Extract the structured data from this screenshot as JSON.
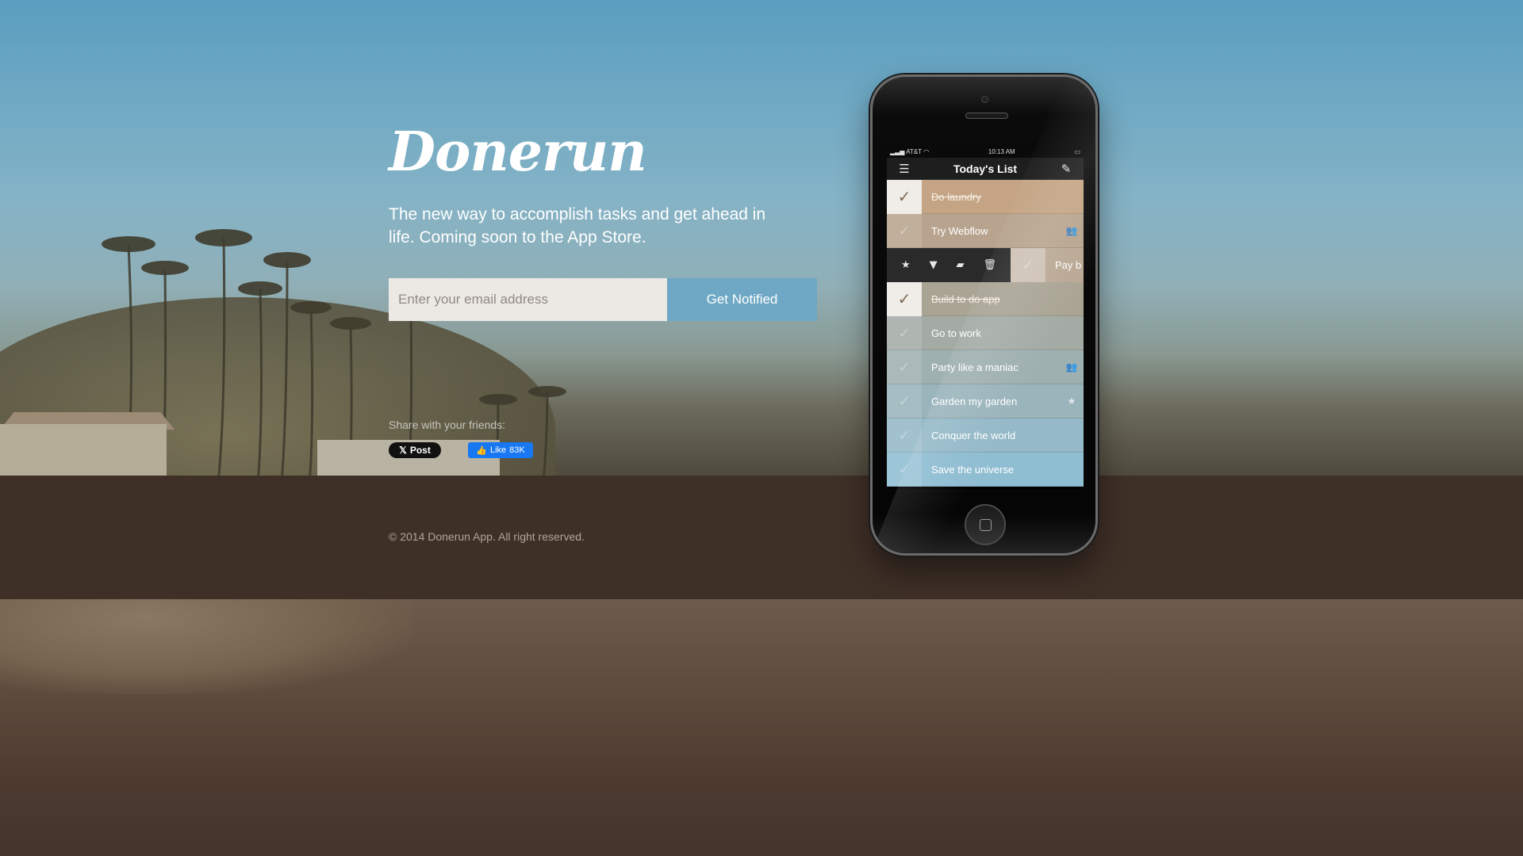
{
  "brand": {
    "logo_text": "Donerun"
  },
  "hero": {
    "tagline": "The new way to accomplish tasks and get ahead in life. Coming soon to the App Store."
  },
  "signup": {
    "email_placeholder": "Enter your email address",
    "email_value": "",
    "button_label": "Get Notified"
  },
  "share": {
    "label": "Share with your friends:",
    "post_label": "Post",
    "like_label": "Like",
    "like_count": "83K"
  },
  "footer": {
    "copyright": "© 2014 Donerun App. All right reserved."
  },
  "phone": {
    "status": {
      "carrier": "AT&T",
      "time": "10:13 AM"
    },
    "nav_title": "Today's List",
    "tasks_top": [
      {
        "label": "Do laundry",
        "done": true,
        "color": "#c4a484",
        "meta_icon": ""
      },
      {
        "label": "Try Webflow",
        "done": false,
        "color": "#b8a48e",
        "meta_icon": "group-icon"
      }
    ],
    "swipe_row": {
      "peek_label": "Pay b"
    },
    "tasks_bottom": [
      {
        "label": "Build to do app",
        "done": true,
        "color": "#a9a494",
        "meta_icon": ""
      },
      {
        "label": "Go to work",
        "done": false,
        "color": "#a4aba5",
        "meta_icon": ""
      },
      {
        "label": "Party like a maniac",
        "done": false,
        "color": "#9fb0b1",
        "meta_icon": "group-icon"
      },
      {
        "label": "Garden my garden",
        "done": false,
        "color": "#9ab4bb",
        "meta_icon": "star-icon"
      },
      {
        "label": "Conquer the world",
        "done": false,
        "color": "#95b9c8",
        "meta_icon": ""
      },
      {
        "label": "Save the universe",
        "done": false,
        "color": "#8fbdd2",
        "meta_icon": ""
      }
    ]
  },
  "colors": {
    "sky": "#5a9ec0",
    "band": "#3f3027",
    "button": "#6ea8c4",
    "input_bg": "#ece8e4"
  }
}
